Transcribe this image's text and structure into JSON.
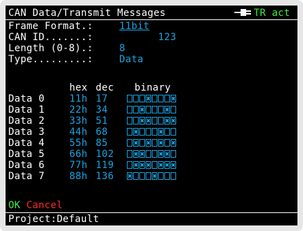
{
  "header": {
    "title": "CAN Data/Transmit Messages",
    "status": "TR act",
    "status_icon": "plug-icon"
  },
  "fields": {
    "frame_format_label": "Frame Format.:",
    "frame_format_value": "11bit",
    "can_id_label": "CAN ID.......:",
    "can_id_value": "123",
    "length_label": "Length (0-8).:",
    "length_value": "8",
    "type_label": "Type.........:",
    "type_value": "Data"
  },
  "table": {
    "headers": [
      "hex",
      "dec",
      "binary"
    ],
    "rows": [
      {
        "label": "Data 0",
        "hex": "11h",
        "dec": "17",
        "bits": [
          0,
          0,
          0,
          1,
          0,
          0,
          0,
          1
        ]
      },
      {
        "label": "Data 1",
        "hex": "22h",
        "dec": "34",
        "bits": [
          0,
          0,
          1,
          0,
          0,
          0,
          1,
          0
        ]
      },
      {
        "label": "Data 2",
        "hex": "33h",
        "dec": "51",
        "bits": [
          0,
          0,
          1,
          1,
          0,
          0,
          1,
          1
        ]
      },
      {
        "label": "Data 3",
        "hex": "44h",
        "dec": "68",
        "bits": [
          0,
          1,
          0,
          0,
          0,
          1,
          0,
          0
        ]
      },
      {
        "label": "Data 4",
        "hex": "55h",
        "dec": "85",
        "bits": [
          0,
          1,
          0,
          1,
          0,
          1,
          0,
          1
        ]
      },
      {
        "label": "Data 5",
        "hex": "66h",
        "dec": "102",
        "bits": [
          0,
          1,
          1,
          0,
          0,
          1,
          1,
          0
        ]
      },
      {
        "label": "Data 6",
        "hex": "77h",
        "dec": "119",
        "bits": [
          0,
          1,
          1,
          1,
          0,
          1,
          1,
          1
        ]
      },
      {
        "label": "Data 7",
        "hex": "88h",
        "dec": "136",
        "bits": [
          1,
          0,
          0,
          0,
          1,
          0,
          0,
          0
        ]
      }
    ]
  },
  "actions": {
    "ok_label": "OK",
    "cancel_label": "Cancel"
  },
  "footer": {
    "project": "Project:Default"
  },
  "colors": {
    "background": "#000000",
    "text": "#ffffff",
    "value": "#1aa3e0",
    "ok": "#3ef03e",
    "cancel": "#ff2a2a",
    "status": "#3ef03e"
  }
}
